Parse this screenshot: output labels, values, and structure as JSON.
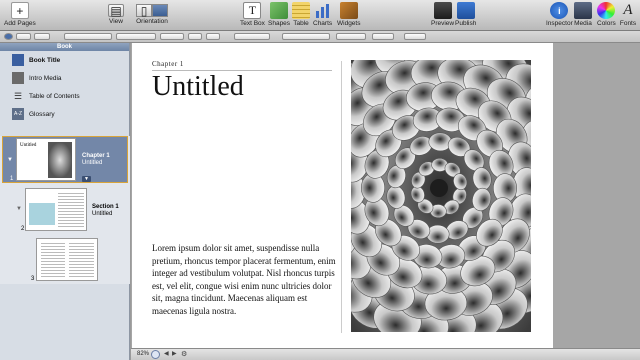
{
  "toolbar": {
    "add_pages": "Add Pages",
    "view": "View",
    "orientation": "Orientation",
    "text_box": "Text Box",
    "shapes": "Shapes",
    "table": "Table",
    "charts": "Charts",
    "widgets": "Widgets",
    "preview": "Preview",
    "publish": "Publish",
    "inspector": "Inspector",
    "media": "Media",
    "colors": "Colors",
    "fonts": "Fonts"
  },
  "sidebar": {
    "header": "Book",
    "items": [
      {
        "label": "Book Title",
        "icon": "book-icon"
      },
      {
        "label": "Intro Media",
        "icon": "media-icon"
      },
      {
        "label": "Table of Contents",
        "icon": "list-icon"
      },
      {
        "label": "Glossary",
        "icon": "az-icon"
      }
    ],
    "chapter": {
      "num": "1",
      "title": "Chapter 1",
      "subtitle": "Untitled"
    },
    "section": {
      "num": "2",
      "title": "Section 1",
      "subtitle": "Untitled"
    },
    "page3": {
      "num": "3"
    },
    "thumb_title": "Untitled"
  },
  "page": {
    "chapter_label": "Chapter 1",
    "title": "Untitled",
    "body": "Lorem ipsum dolor sit amet, suspendisse nulla pretium, rhoncus tempor placerat fermentum, enim integer ad vestibulum volutpat. Nisl rhoncus turpis est, vel elit, congue wisi enim nunc ultricies dolor sit, magna tincidunt. Maecenas aliquam est maecenas ligula nostra."
  },
  "status": {
    "zoom": "82%"
  }
}
